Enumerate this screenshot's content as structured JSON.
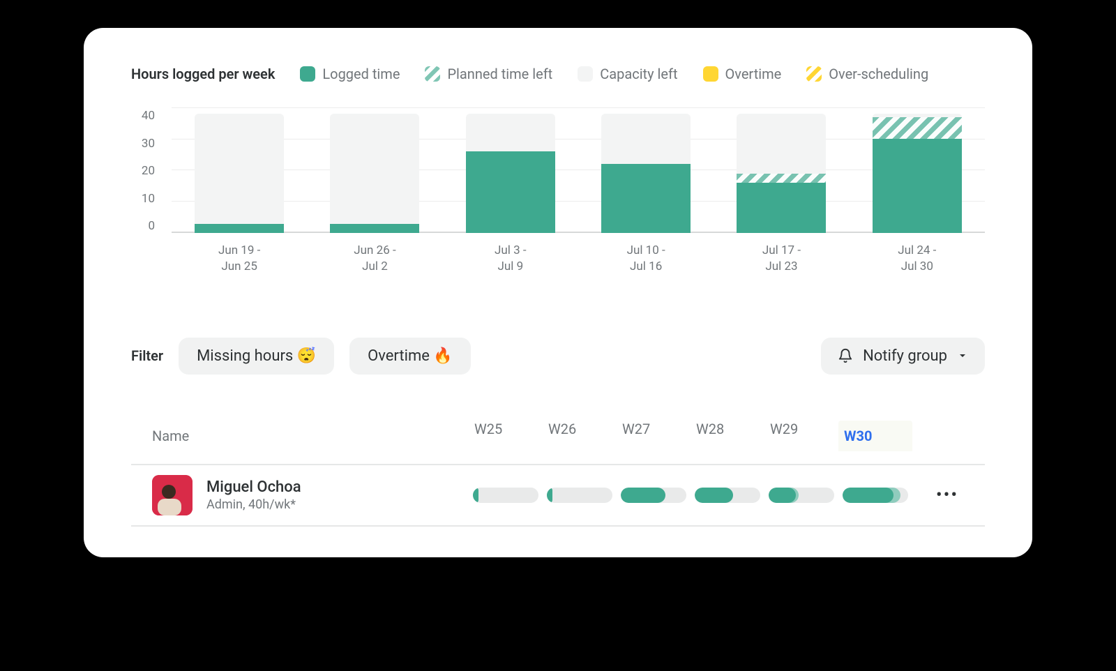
{
  "header": {
    "title": "Hours logged per week",
    "legend": {
      "logged": "Logged time",
      "planned": "Planned time left",
      "capacity": "Capacity left",
      "overtime": "Overtime",
      "oversched": "Over-scheduling"
    }
  },
  "chart_data": {
    "type": "bar",
    "title": "Hours logged per week",
    "ylabel": "",
    "xlabel": "",
    "ylim": [
      0,
      40
    ],
    "yticks": [
      0,
      10,
      20,
      30,
      40
    ],
    "categories": [
      "Jun 19 - Jun 25",
      "Jun 26 - Jul 2",
      "Jul 3 - Jul 9",
      "Jul 10 - Jul 16",
      "Jul 17 - Jul 23",
      "Jul 24 - Jul 30"
    ],
    "capacity_total": 38,
    "series": [
      {
        "name": "Logged time",
        "values": [
          3,
          3,
          26,
          22,
          16,
          30
        ]
      },
      {
        "name": "Planned time left",
        "values": [
          0,
          0,
          0,
          0,
          3,
          7
        ]
      },
      {
        "name": "Capacity left",
        "values": [
          35,
          35,
          12,
          16,
          19,
          1
        ]
      }
    ],
    "legend": [
      "Logged time",
      "Planned time left",
      "Capacity left",
      "Overtime",
      "Over-scheduling"
    ]
  },
  "filter": {
    "label": "Filter",
    "chips": {
      "missing": "Missing hours 😴",
      "overtime": "Overtime 🔥"
    },
    "notify": "Notify group"
  },
  "table": {
    "headers": {
      "name": "Name",
      "weeks": [
        "W25",
        "W26",
        "W27",
        "W28",
        "W29",
        "W30"
      ]
    },
    "current_week_index": 5,
    "rows": [
      {
        "name": "Miguel Ochoa",
        "role": "Admin, 40h/wk*",
        "weeks": [
          {
            "logged_pct": 8,
            "planned_pct": 0
          },
          {
            "logged_pct": 8,
            "planned_pct": 0
          },
          {
            "logged_pct": 68,
            "planned_pct": 0
          },
          {
            "logged_pct": 58,
            "planned_pct": 0
          },
          {
            "logged_pct": 42,
            "planned_pct": 46
          },
          {
            "logged_pct": 78,
            "planned_pct": 88
          }
        ]
      }
    ]
  }
}
